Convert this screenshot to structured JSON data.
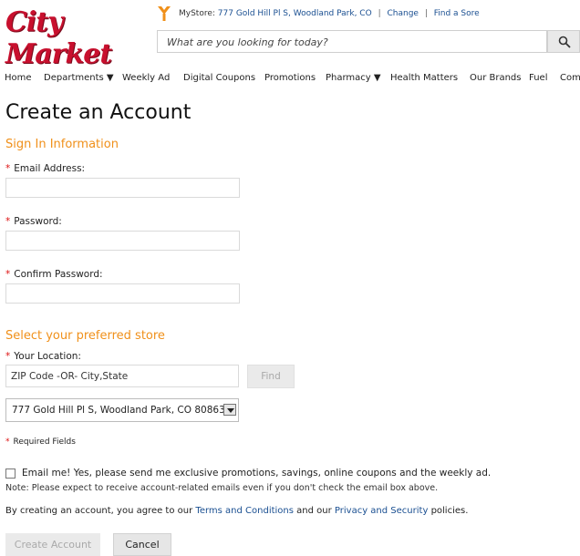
{
  "header": {
    "logo_text": "City Market",
    "mystore_label": "MyStore:",
    "store_address": "777 Gold Hill Pl S, Woodland Park, CO",
    "change_link": "Change",
    "find_store_link": "Find a Sore",
    "search_placeholder": "What are you looking for today?"
  },
  "nav": {
    "items": [
      "Home",
      "Departments ▼",
      "Weekly Ad",
      "Digital Coupons",
      "Promotions",
      "Pharmacy ▼",
      "Health Matters",
      "Our Brands",
      "Fuel",
      "Com"
    ]
  },
  "page": {
    "title": "Create an Account",
    "signin_heading": "Sign In Information",
    "email_label": "Email Address:",
    "password_label": "Password:",
    "confirm_label": "Confirm Password:",
    "store_heading": "Select your preferred store",
    "location_label": "Your Location:",
    "location_placeholder": "ZIP Code -OR- City,State",
    "find_label": "Find",
    "selected_store": "777 Gold Hill Pl S, Woodland Park, CO 80863",
    "required_note": "Required Fields",
    "email_optin": "Email me! Yes, please send me exclusive promotions, savings, online coupons and the weekly ad.",
    "note": "Note: Please expect to receive account-related emails even if you don't check the email box above.",
    "terms_prefix": "By creating an account, you agree to our",
    "terms_link": "Terms and Conditions",
    "terms_mid": "and our",
    "privacy_link": "Privacy and Security",
    "terms_suffix": "policies.",
    "create_button": "Create Account",
    "cancel_button": "Cancel"
  },
  "colors": {
    "brand_red": "#c8102e",
    "section_orange": "#f0901a",
    "link_blue": "#1a4f91"
  }
}
